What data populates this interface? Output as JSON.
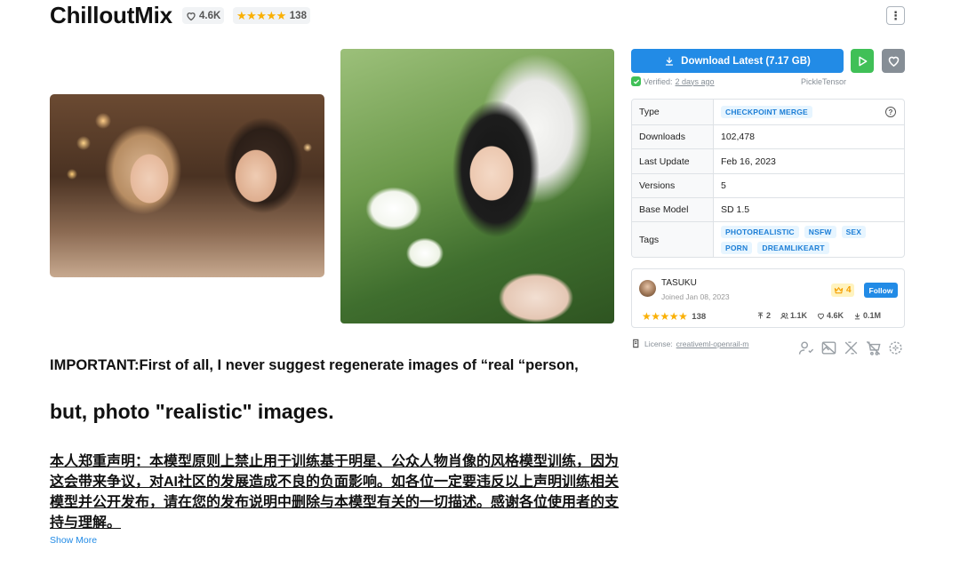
{
  "header": {
    "title": "ChilloutMix",
    "likes": "4.6K",
    "rating_count": "138",
    "stars": "★★★★★",
    "menu_glyph": "⋮"
  },
  "download": {
    "label": "Download Latest (7.17 GB)",
    "verified_prefix": "Verified:",
    "verified_when": "2 days ago",
    "uploader": "PickleTensor"
  },
  "info": {
    "rows": [
      {
        "key": "Type",
        "value": "CHECKPOINT MERGE"
      },
      {
        "key": "Downloads",
        "value": "102,478"
      },
      {
        "key": "Last Update",
        "value": "Feb 16, 2023"
      },
      {
        "key": "Versions",
        "value": "5"
      },
      {
        "key": "Base Model",
        "value": "SD 1.5"
      },
      {
        "key": "Tags",
        "value": ""
      }
    ],
    "help_glyph": "?",
    "tags": [
      "PHOTOREALISTIC",
      "NSFW",
      "SEX",
      "PORN",
      "DREAMLIKEART"
    ]
  },
  "creator": {
    "name": "TASUKU",
    "joined": "Joined Jan 08, 2023",
    "crown_count": "4",
    "follow_label": "Follow",
    "stars": "★★★★★",
    "rating_count": "138",
    "uploads": "2",
    "followers": "1.1K",
    "likes": "4.6K",
    "downloads": "0.1M"
  },
  "license": {
    "prefix": "License:",
    "name": "creativeml-openrail-m"
  },
  "description": {
    "line1": "IMPORTANT:First of all, I never suggest regenerate images of “real “person,",
    "line2": "but, photo \"realistic\" images.",
    "line3": "本人郑重声明：本模型原则上禁止用于训练基于明星、公众人物肖像的风格模型训练，因为这会带来争议，对AI社区的发展造成不良的负面影响。如各位一定要违反以上声明训练相关模型并公开发布，请在您的发布说明中删除与本模型有关的一切描述。感谢各位使用者的支持与理解。",
    "show_more": "Show More"
  },
  "colors": {
    "primary": "#228be6",
    "success": "#40c057",
    "star": "#fab005",
    "badge_bg": "#e7f5ff",
    "badge_text": "#1c7ed6"
  }
}
